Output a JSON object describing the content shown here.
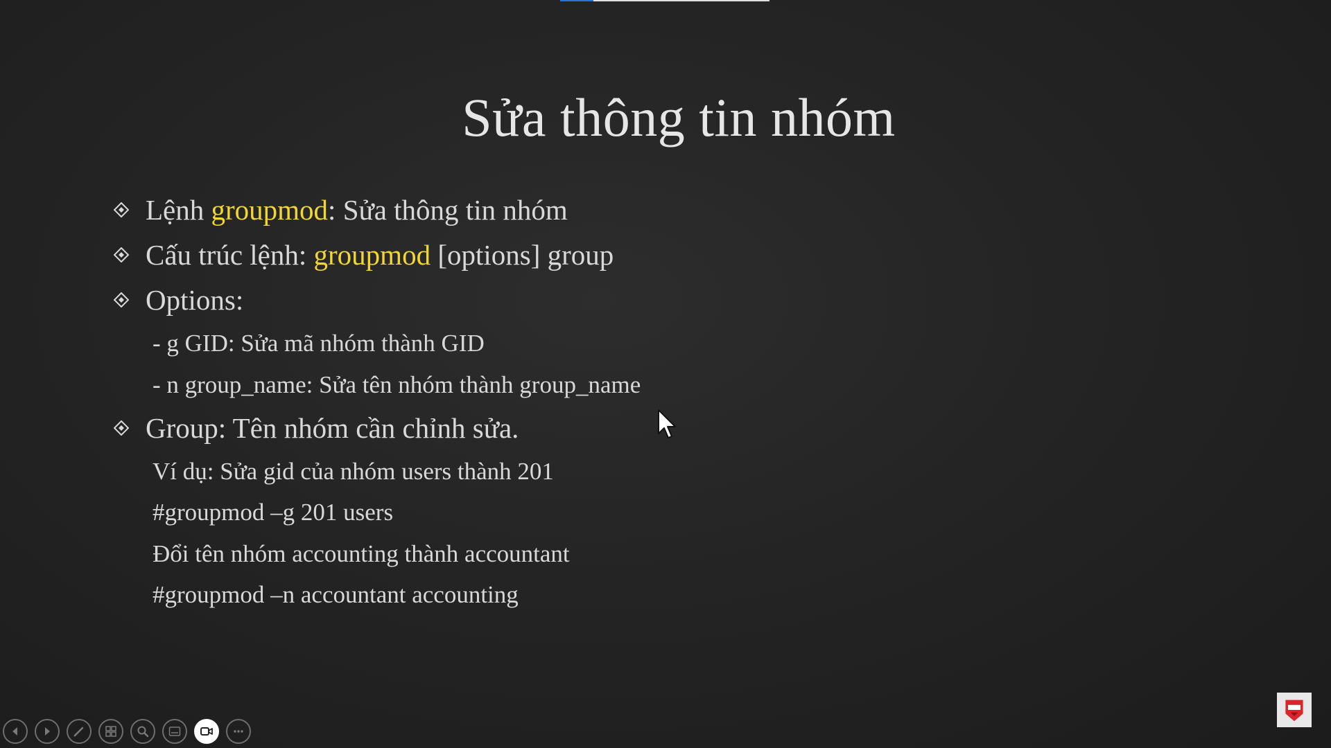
{
  "slide": {
    "title": "Sửa thông tin nhóm",
    "bullets": [
      {
        "prefix": "Lệnh ",
        "highlight": "groupmod",
        "suffix": ": Sửa thông tin nhóm"
      },
      {
        "prefix": "Cấu trúc lệnh: ",
        "highlight": "groupmod",
        "suffix": " [options] group"
      },
      {
        "text": "Options:"
      },
      {
        "text": "Group: Tên nhóm cần chỉnh sửa."
      }
    ],
    "options_lines": [
      "- g GID: Sửa mã nhóm thành GID",
      "- n group_name: Sửa tên nhóm thành group_name"
    ],
    "example_lines": [
      "Ví dụ: Sửa gid của nhóm users thành 201",
      "#groupmod –g 201 users",
      "Đổi tên nhóm accounting thành accountant",
      "#groupmod –n accountant accounting"
    ],
    "highlight_color": "#f2d631",
    "text_color": "#d9d9d9"
  },
  "presentation": {
    "progress_fraction": 0.16
  },
  "toolbar": {
    "buttons": [
      {
        "icon": "previous-icon"
      },
      {
        "icon": "next-icon"
      },
      {
        "icon": "pen-icon"
      },
      {
        "icon": "see-all-slides-icon"
      },
      {
        "icon": "zoom-icon"
      },
      {
        "icon": "subtitles-icon"
      },
      {
        "icon": "camera-icon",
        "active": true
      },
      {
        "icon": "more-options-icon"
      }
    ]
  }
}
